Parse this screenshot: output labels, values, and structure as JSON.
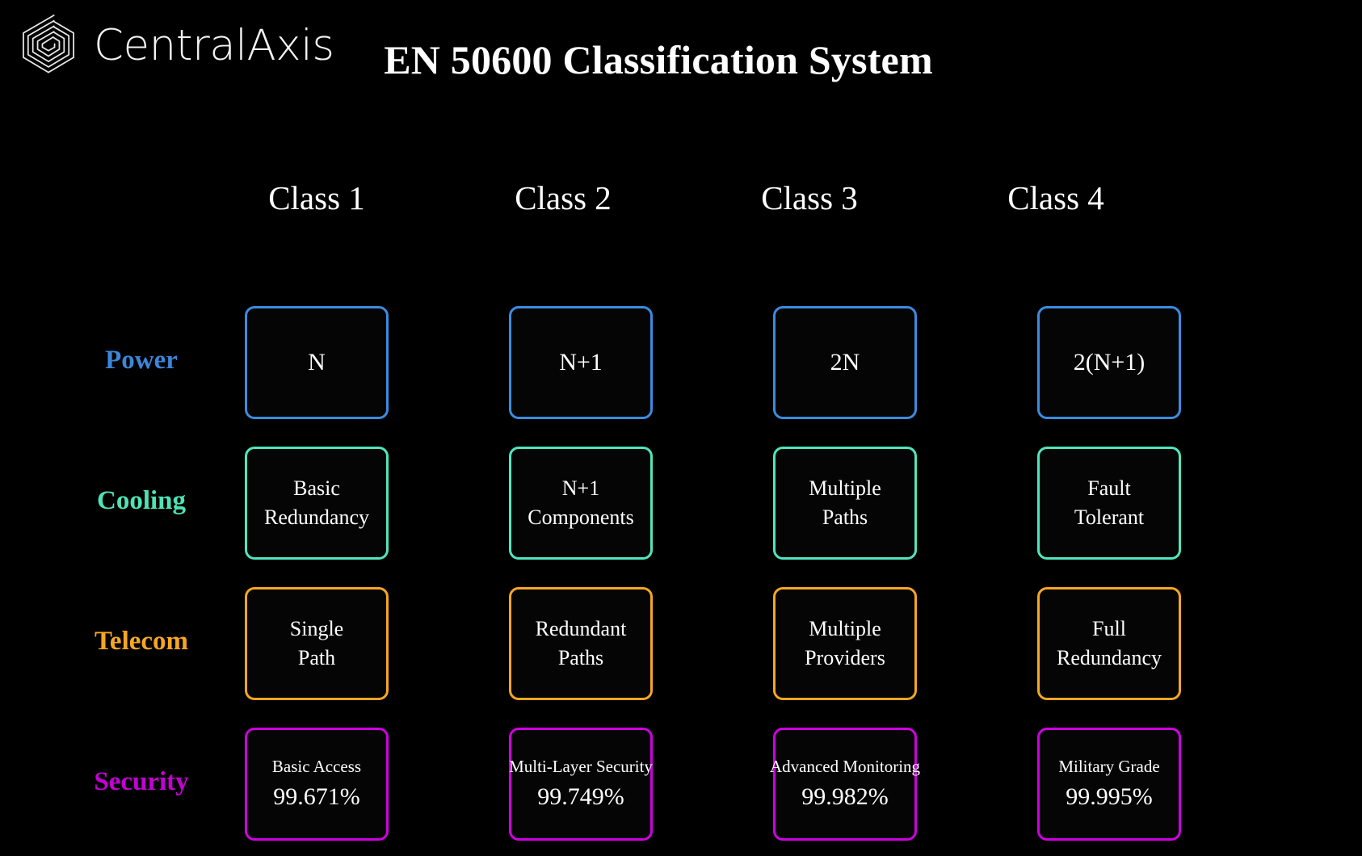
{
  "brand": {
    "name": "CentralAxis",
    "logo_icon": "hexagon-spiral-icon"
  },
  "header": {
    "title": "EN 50600 Classification System"
  },
  "colors": {
    "background": "#000000",
    "text": "#ffffff",
    "power": "#3d85d8",
    "cooling": "#4ee3b5",
    "telecom": "#f5a623",
    "security": "#c400d4",
    "power_border": "#3b8ce0",
    "cooling_border": "#4fe6bd",
    "telecom_border": "#f5a623",
    "security_border": "#cf00e0"
  },
  "matrix": {
    "columns": [
      {
        "label": "Class 1"
      },
      {
        "label": "Class 2"
      },
      {
        "label": "Class 3"
      },
      {
        "label": "Class 4"
      }
    ],
    "rows": [
      {
        "key": "power",
        "label": "Power",
        "cells": [
          {
            "lines": [
              "N"
            ]
          },
          {
            "lines": [
              "N+1"
            ]
          },
          {
            "lines": [
              "2N"
            ]
          },
          {
            "lines": [
              "2(N+1)"
            ]
          }
        ]
      },
      {
        "key": "cooling",
        "label": "Cooling",
        "cells": [
          {
            "lines": [
              "Basic",
              "Redundancy"
            ]
          },
          {
            "lines": [
              "N+1",
              "Components"
            ]
          },
          {
            "lines": [
              "Multiple",
              "Paths"
            ]
          },
          {
            "lines": [
              "Fault",
              "Tolerant"
            ]
          }
        ]
      },
      {
        "key": "telecom",
        "label": "Telecom",
        "cells": [
          {
            "lines": [
              "Single",
              "Path"
            ]
          },
          {
            "lines": [
              "Redundant",
              "Paths"
            ]
          },
          {
            "lines": [
              "Multiple",
              "Providers"
            ]
          },
          {
            "lines": [
              "Full",
              "Redundancy"
            ]
          }
        ]
      },
      {
        "key": "security",
        "label": "Security",
        "cells": [
          {
            "label": "Basic Access",
            "value": "99.671%"
          },
          {
            "label": "Multi-Layer Security",
            "value": "99.749%"
          },
          {
            "label": "Advanced Monitoring",
            "value": "99.982%"
          },
          {
            "label": "Military Grade",
            "value": "99.995%"
          }
        ]
      }
    ]
  }
}
